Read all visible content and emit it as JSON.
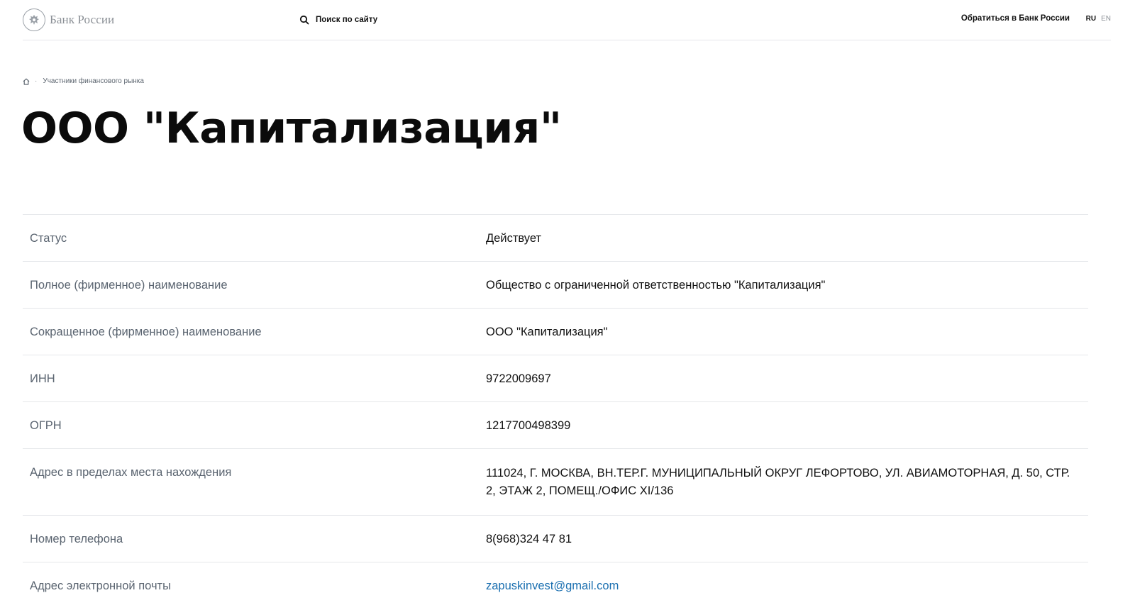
{
  "header": {
    "logo_text": "Банк России",
    "search_label": "Поиск по сайту",
    "contact_link": "Обратиться в Банк России",
    "lang_ru": "RU",
    "lang_en": "EN"
  },
  "breadcrumb": {
    "separator": "·",
    "items": [
      "Участники финансового рынка"
    ]
  },
  "page_title": "ООО \"Капитализация\"",
  "details": [
    {
      "label": "Статус",
      "value": "Действует"
    },
    {
      "label": "Полное (фирменное) наименование",
      "value": "Общество с ограниченной ответственностью \"Капитализация\""
    },
    {
      "label": "Сокращенное (фирменное) наименование",
      "value": "ООО \"Капитализация\""
    },
    {
      "label": "ИНН",
      "value": "9722009697"
    },
    {
      "label": "ОГРН",
      "value": "1217700498399"
    },
    {
      "label": "Адрес в пределах места нахождения",
      "value": "111024, Г. МОСКВА, ВН.ТЕР.Г. МУНИЦИПАЛЬНЫЙ ОКРУГ ЛЕФОРТОВО, УЛ. АВИАМОТОРНАЯ, Д. 50, СТР. 2, ЭТАЖ 2, ПОМЕЩ./ОФИС XI/136"
    },
    {
      "label": "Номер телефона",
      "value": "8(968)324 47 81"
    },
    {
      "label": "Адрес электронной почты",
      "value": "zapuskinvest@gmail.com"
    }
  ],
  "colors": {
    "link": "#1a6fb0",
    "label_text": "#5a6470",
    "divider": "#e5e7ea"
  }
}
